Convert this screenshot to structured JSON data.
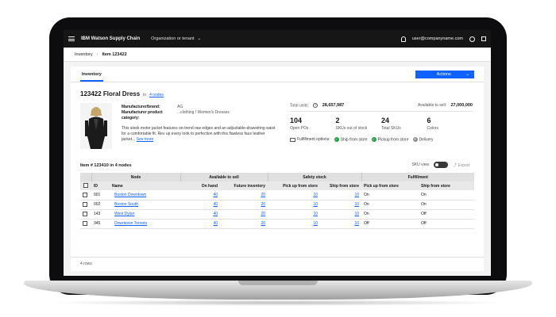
{
  "header": {
    "brand": "IBM Watson Supply Chain",
    "org_selector": "Organization or tenant",
    "user_email": "user@companyname.com"
  },
  "breadcrumb": {
    "root": "Inventory",
    "current": "Item 123422"
  },
  "tabs": [
    {
      "label": "Inventory"
    }
  ],
  "actions": {
    "label": "Actions"
  },
  "item": {
    "title": "123422 Floral Dress",
    "in_label": "in",
    "nodes_link": "4 nodes",
    "brand_key": "Manufacturer/brand:",
    "brand_val": "AG",
    "category_key": "Manufacturer product category:",
    "category_val": "...clothing / Women's Dresses",
    "description": "This sleek motor jacket features on-trend raw edges and an adjustable-drawstring waist for a comfortable fit. Rev up every look to perfection with this flawless faux leather jacket...",
    "see_more": "See more"
  },
  "stats": {
    "total_units_label": "Total units:",
    "total_units": "28,657,987",
    "available_label": "Available to sell:",
    "available": "27,000,000",
    "tiles": [
      {
        "num": "104",
        "caption": "Open POs"
      },
      {
        "num": "2",
        "caption": "SKUs out of stock"
      },
      {
        "num": "24",
        "caption": "Total SKUs"
      },
      {
        "num": "6",
        "caption": "Colors"
      }
    ],
    "fulfillment_label": "Fulfillment options:",
    "options": [
      "Ship from store",
      "Pickup from store",
      "Delivery"
    ]
  },
  "table": {
    "title": "Item # 123410 in 4 nodes",
    "sku_view_label": "SKU view",
    "export_label": "Export",
    "group_headers": [
      "Node",
      "Available to sell",
      "Safety stock",
      "Fulfillment"
    ],
    "columns": [
      "ID",
      "Name",
      "On hand",
      "Future inventory",
      "Pick up from store",
      "Ship from store",
      "Pick up from store",
      "Ship from store"
    ],
    "rows": [
      {
        "id": "001",
        "name": "Boston Downtown",
        "on_hand": "40",
        "future": "20",
        "ss_pickup": "10",
        "ss_ship": "10",
        "f_pickup": "On",
        "f_ship": "On"
      },
      {
        "id": "002",
        "name": "Boston South",
        "on_hand": "40",
        "future": "20",
        "ss_pickup": "10",
        "ss_ship": "10",
        "f_pickup": "On",
        "f_ship": "On"
      },
      {
        "id": "143",
        "name": "West Dylan",
        "on_hand": "40",
        "future": "20",
        "ss_pickup": "10",
        "ss_ship": "10",
        "f_pickup": "On",
        "f_ship": "Off"
      },
      {
        "id": "345",
        "name": "Downtown Toronto",
        "on_hand": "40",
        "future": "20",
        "ss_pickup": "10",
        "ss_ship": "10",
        "f_pickup": "Off",
        "f_ship": "Off"
      }
    ],
    "footer": "4 rows"
  },
  "colors": {
    "accent": "#0f62fe",
    "header_bg": "#161616",
    "success": "#24a148"
  }
}
